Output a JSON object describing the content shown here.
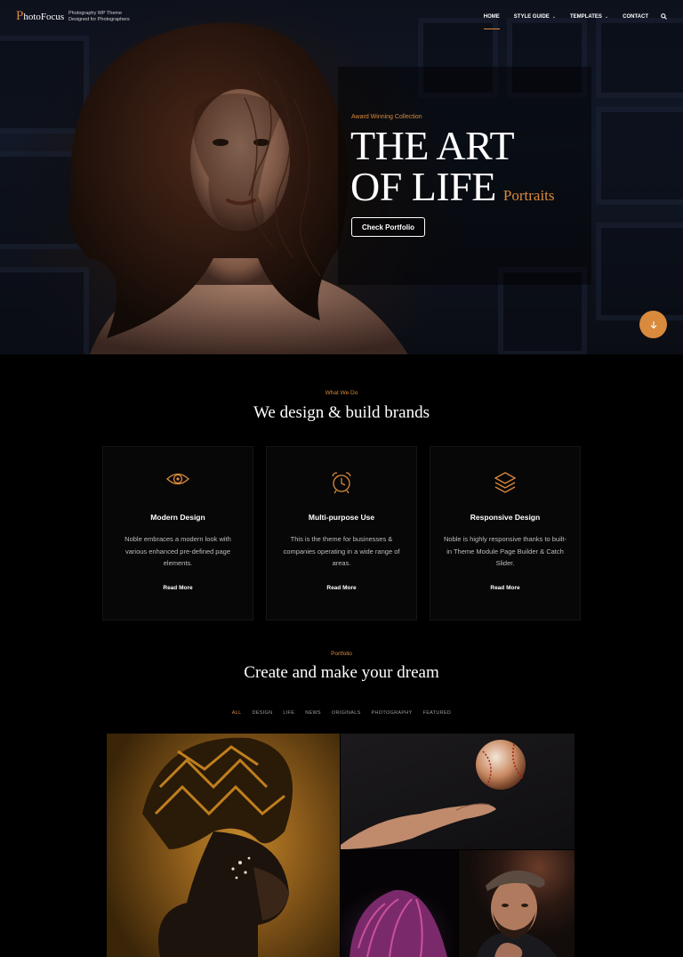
{
  "header": {
    "logo_initial": "P",
    "logo_rest": "hotoFocus",
    "tagline_line1": "Photography WP Theme",
    "tagline_line2": "Designed for Photographers",
    "nav": [
      {
        "label": "HOME",
        "active": true,
        "dropdown": false
      },
      {
        "label": "STYLE GUIDE",
        "active": false,
        "dropdown": true
      },
      {
        "label": "TEMPLATES",
        "active": false,
        "dropdown": true
      },
      {
        "label": "CONTACT",
        "active": false,
        "dropdown": false
      }
    ],
    "search_icon": "search-icon"
  },
  "hero": {
    "eyebrow": "Award Winning Collection",
    "title_line1": "THE ART",
    "title_line2": "OF LIFE",
    "subtitle": "Portraits",
    "button_label": "Check Portfolio",
    "scroll_icon": "arrow-down-icon"
  },
  "services": {
    "eyebrow": "What We Do",
    "title": "We design & build brands",
    "cards": [
      {
        "icon": "eye-icon",
        "title": "Modern Design",
        "desc": "Noble embraces a modern look with various enhanced pre-defined page elements.",
        "more": "Read More"
      },
      {
        "icon": "alarm-clock-icon",
        "title": "Multi-purpose Use",
        "desc": "This is the theme for businesses & companies operating in a wide range of areas.",
        "more": "Read More"
      },
      {
        "icon": "layers-icon",
        "title": "Responsive Design",
        "desc": "Noble is highly responsive thanks to built-in Theme Module Page Builder & Catch Slider.",
        "more": "Read More"
      }
    ]
  },
  "portfolio": {
    "eyebrow": "Portfolio",
    "title": "Create and make your dream",
    "filters": [
      "ALL",
      "DESIGN",
      "LIFE",
      "NEWS",
      "ORIGINALS",
      "PHOTOGRAPHY",
      "FEATURED"
    ],
    "active_filter": "ALL"
  },
  "colors": {
    "accent": "#d98a3c",
    "background": "#000000",
    "card_background": "#070707"
  }
}
